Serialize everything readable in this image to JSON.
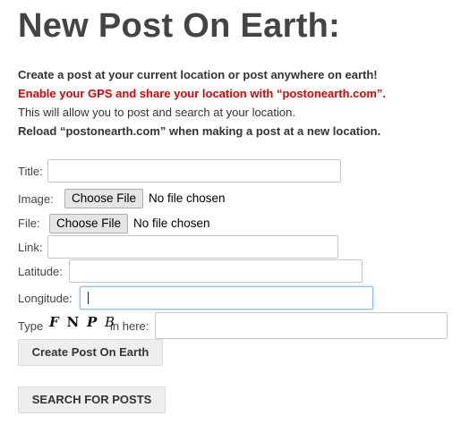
{
  "page": {
    "title": "New Post On Earth:"
  },
  "intro": {
    "line1": "Create a post at your current location or post anywhere on earth!",
    "line2": "Enable your GPS and share your location with “postonearth.com”.",
    "line3": "This will allow you to post and search at your location.",
    "line4": "Reload “postonearth.com” when making a post at a new location."
  },
  "form": {
    "title_label": "Title:",
    "title_value": "",
    "image_label": "Image:",
    "image_button": "Choose File",
    "image_status": "No file chosen",
    "file_label": "File:",
    "file_button": "Choose File",
    "file_status": "No file chosen",
    "link_label": "Link:",
    "link_value": "",
    "latitude_label": "Latitude:",
    "latitude_value": "",
    "longitude_label": "Longitude:",
    "longitude_value": "",
    "captcha_prefix": "Type",
    "captcha_chars": [
      "F",
      "N",
      "P",
      "B"
    ],
    "captcha_suffix": "in here:",
    "captcha_value": ""
  },
  "buttons": {
    "create": "Create Post On Earth",
    "search": "SEARCH FOR POSTS"
  },
  "colors": {
    "warning": "#e00000",
    "focus_border": "#8fbce6"
  }
}
